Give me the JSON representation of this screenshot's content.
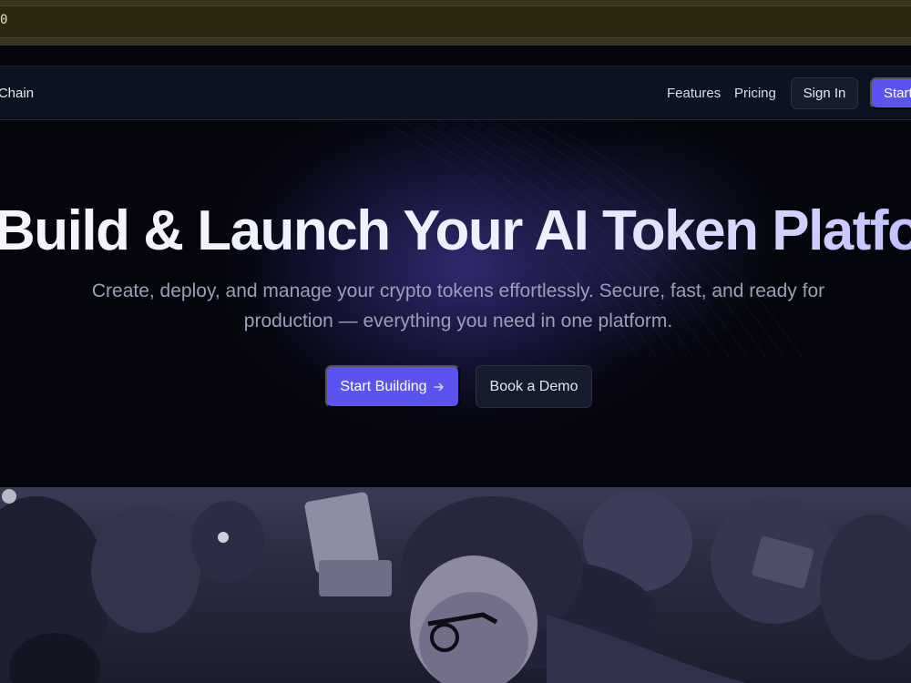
{
  "dev_strip": {
    "text": "0"
  },
  "nav": {
    "brand": "vnChain",
    "links": [
      "Features",
      "Pricing"
    ],
    "sign_in": "Sign In",
    "start": "Start"
  },
  "hero": {
    "title": "Build & Launch Your AI Token Platform",
    "subtitle": "Create, deploy, and manage your crypto tokens effortlessly. Secure, fast, and ready for production — everything you need in one platform.",
    "primary_button": "Start Building",
    "primary_icon": "arrow-right-icon",
    "secondary_button": "Book a Demo"
  },
  "colors": {
    "accent": "#5b53f0",
    "background": "#05060d",
    "nav_bg": "#0d1220"
  }
}
